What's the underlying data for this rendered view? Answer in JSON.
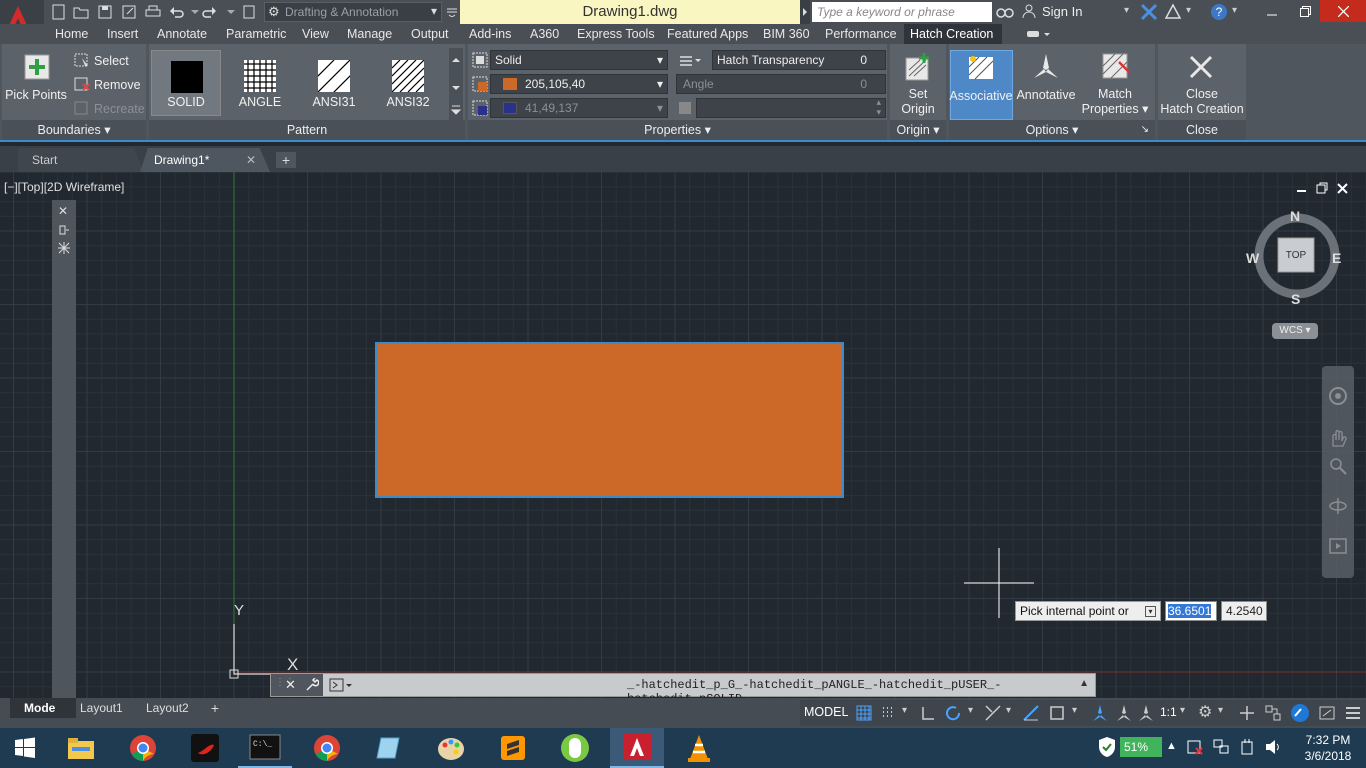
{
  "app": {
    "title": "Drawing1.dwg",
    "workspace": "Drafting & Annotation",
    "search_placeholder": "Type a keyword or phrase",
    "sign_in": "Sign In"
  },
  "ribbon_tabs": [
    "Home",
    "Insert",
    "Annotate",
    "Parametric",
    "View",
    "Manage",
    "Output",
    "Add-ins",
    "A360",
    "Express Tools",
    "Featured Apps",
    "BIM 360",
    "Performance",
    "Hatch Creation"
  ],
  "active_tab": "Hatch Creation",
  "boundaries": {
    "pick_points": "Pick Points",
    "select": "Select",
    "remove": "Remove",
    "recreate": "Recreate",
    "title": "Boundaries"
  },
  "pattern": {
    "items": [
      "SOLID",
      "ANGLE",
      "ANSI31",
      "ANSI32"
    ],
    "selected": "SOLID",
    "title": "Pattern"
  },
  "properties": {
    "hatch_type": "Solid",
    "color1": "205,105,40",
    "color2": "41,49,137",
    "transparency_label": "Hatch Transparency",
    "transparency_value": "0",
    "angle_label": "Angle",
    "angle_value": "0",
    "title": "Properties"
  },
  "origin": {
    "set_origin_line1": "Set",
    "set_origin_line2": "Origin",
    "title": "Origin"
  },
  "options": {
    "associative": "Associative",
    "annotative": "Annotative",
    "match_line1": "Match",
    "match_line2": "Properties",
    "title": "Options"
  },
  "close": {
    "line1": "Close",
    "line2": "Hatch Creation",
    "title": "Close"
  },
  "file_tabs": [
    "Start",
    "Drawing1*"
  ],
  "active_file_tab": "Drawing1*",
  "viewport_label": "[−][Top][2D Wireframe]",
  "viewcube": {
    "n": "N",
    "s": "S",
    "e": "E",
    "w": "W",
    "face": "TOP",
    "wcs": "WCS"
  },
  "ucs": {
    "x": "X",
    "y": "Y"
  },
  "tooltip": {
    "prompt": "Pick internal point or",
    "x_value": "36.6501",
    "y_value": "4.2540"
  },
  "command_line": "_-hatchedit_p_G_-hatchedit_pANGLE_-hatchedit_pUSER_-hatchedit_pSOLID",
  "layout_tabs": [
    "Model",
    "Layout1",
    "Layout2"
  ],
  "model_tab_visible": "Mode",
  "status": {
    "model": "MODEL",
    "scale": "1:1"
  },
  "taskbar": {
    "battery": "51%",
    "time": "7:32 PM",
    "date": "3/6/2018"
  },
  "colors": {
    "hatch_fill": "#cd6928",
    "selection_blue": "#3d8acb",
    "color2": "#29318a"
  }
}
